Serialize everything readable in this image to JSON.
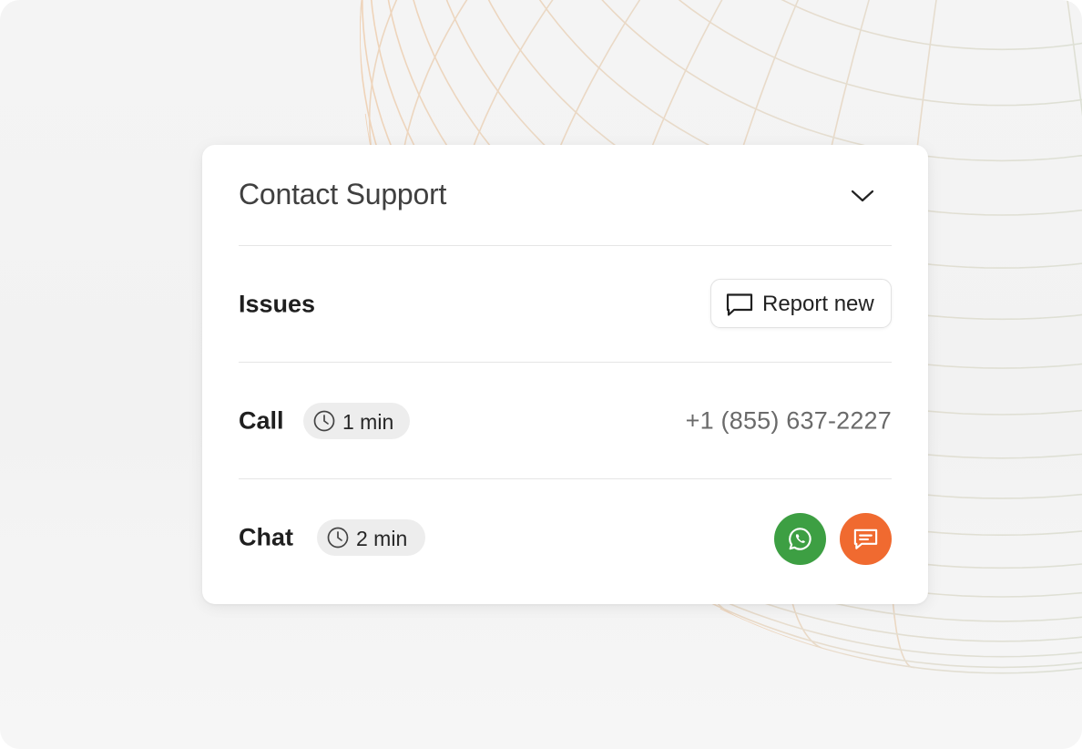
{
  "panel": {
    "title": "Contact Support",
    "collapse_icon": "chevron-down-icon"
  },
  "issues": {
    "label": "Issues",
    "report_button_label": "Report new",
    "report_icon": "message-square-icon"
  },
  "call": {
    "label": "Call",
    "wait_time": "1 min",
    "wait_icon": "clock-icon",
    "phone_number": "+1 (855) 637-2227"
  },
  "chat": {
    "label": "Chat",
    "wait_time": "2 min",
    "wait_icon": "clock-icon",
    "channels": [
      {
        "name": "whatsapp-icon",
        "color": "#3d9f43"
      },
      {
        "name": "chat-bubble-icon",
        "color": "#f06a30"
      }
    ]
  },
  "colors": {
    "background": "#f3f3f3",
    "card": "#ffffff",
    "divider": "#e6e6e6",
    "badge": "#ededed",
    "whatsapp": "#3d9f43",
    "chat_accent": "#f06a30",
    "globe_lines_warm": "#efd9c4",
    "globe_lines_cool": "#dbe4dd"
  }
}
